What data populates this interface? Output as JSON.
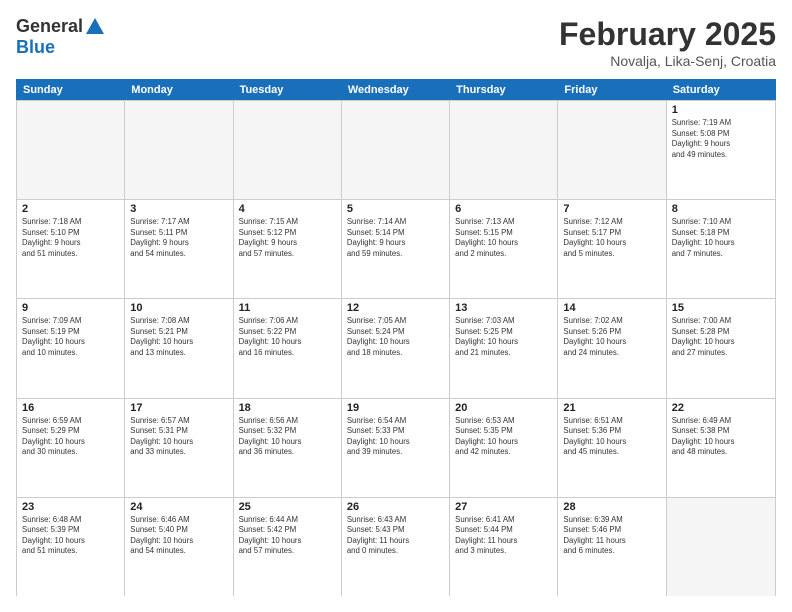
{
  "header": {
    "logo_line1": "General",
    "logo_line2": "Blue",
    "title": "February 2025",
    "subtitle": "Novalja, Lika-Senj, Croatia"
  },
  "weekdays": [
    "Sunday",
    "Monday",
    "Tuesday",
    "Wednesday",
    "Thursday",
    "Friday",
    "Saturday"
  ],
  "weeks": [
    [
      {
        "day": "",
        "info": ""
      },
      {
        "day": "",
        "info": ""
      },
      {
        "day": "",
        "info": ""
      },
      {
        "day": "",
        "info": ""
      },
      {
        "day": "",
        "info": ""
      },
      {
        "day": "",
        "info": ""
      },
      {
        "day": "1",
        "info": "Sunrise: 7:19 AM\nSunset: 5:08 PM\nDaylight: 9 hours\nand 49 minutes."
      }
    ],
    [
      {
        "day": "2",
        "info": "Sunrise: 7:18 AM\nSunset: 5:10 PM\nDaylight: 9 hours\nand 51 minutes."
      },
      {
        "day": "3",
        "info": "Sunrise: 7:17 AM\nSunset: 5:11 PM\nDaylight: 9 hours\nand 54 minutes."
      },
      {
        "day": "4",
        "info": "Sunrise: 7:15 AM\nSunset: 5:12 PM\nDaylight: 9 hours\nand 57 minutes."
      },
      {
        "day": "5",
        "info": "Sunrise: 7:14 AM\nSunset: 5:14 PM\nDaylight: 9 hours\nand 59 minutes."
      },
      {
        "day": "6",
        "info": "Sunrise: 7:13 AM\nSunset: 5:15 PM\nDaylight: 10 hours\nand 2 minutes."
      },
      {
        "day": "7",
        "info": "Sunrise: 7:12 AM\nSunset: 5:17 PM\nDaylight: 10 hours\nand 5 minutes."
      },
      {
        "day": "8",
        "info": "Sunrise: 7:10 AM\nSunset: 5:18 PM\nDaylight: 10 hours\nand 7 minutes."
      }
    ],
    [
      {
        "day": "9",
        "info": "Sunrise: 7:09 AM\nSunset: 5:19 PM\nDaylight: 10 hours\nand 10 minutes."
      },
      {
        "day": "10",
        "info": "Sunrise: 7:08 AM\nSunset: 5:21 PM\nDaylight: 10 hours\nand 13 minutes."
      },
      {
        "day": "11",
        "info": "Sunrise: 7:06 AM\nSunset: 5:22 PM\nDaylight: 10 hours\nand 16 minutes."
      },
      {
        "day": "12",
        "info": "Sunrise: 7:05 AM\nSunset: 5:24 PM\nDaylight: 10 hours\nand 18 minutes."
      },
      {
        "day": "13",
        "info": "Sunrise: 7:03 AM\nSunset: 5:25 PM\nDaylight: 10 hours\nand 21 minutes."
      },
      {
        "day": "14",
        "info": "Sunrise: 7:02 AM\nSunset: 5:26 PM\nDaylight: 10 hours\nand 24 minutes."
      },
      {
        "day": "15",
        "info": "Sunrise: 7:00 AM\nSunset: 5:28 PM\nDaylight: 10 hours\nand 27 minutes."
      }
    ],
    [
      {
        "day": "16",
        "info": "Sunrise: 6:59 AM\nSunset: 5:29 PM\nDaylight: 10 hours\nand 30 minutes."
      },
      {
        "day": "17",
        "info": "Sunrise: 6:57 AM\nSunset: 5:31 PM\nDaylight: 10 hours\nand 33 minutes."
      },
      {
        "day": "18",
        "info": "Sunrise: 6:56 AM\nSunset: 5:32 PM\nDaylight: 10 hours\nand 36 minutes."
      },
      {
        "day": "19",
        "info": "Sunrise: 6:54 AM\nSunset: 5:33 PM\nDaylight: 10 hours\nand 39 minutes."
      },
      {
        "day": "20",
        "info": "Sunrise: 6:53 AM\nSunset: 5:35 PM\nDaylight: 10 hours\nand 42 minutes."
      },
      {
        "day": "21",
        "info": "Sunrise: 6:51 AM\nSunset: 5:36 PM\nDaylight: 10 hours\nand 45 minutes."
      },
      {
        "day": "22",
        "info": "Sunrise: 6:49 AM\nSunset: 5:38 PM\nDaylight: 10 hours\nand 48 minutes."
      }
    ],
    [
      {
        "day": "23",
        "info": "Sunrise: 6:48 AM\nSunset: 5:39 PM\nDaylight: 10 hours\nand 51 minutes."
      },
      {
        "day": "24",
        "info": "Sunrise: 6:46 AM\nSunset: 5:40 PM\nDaylight: 10 hours\nand 54 minutes."
      },
      {
        "day": "25",
        "info": "Sunrise: 6:44 AM\nSunset: 5:42 PM\nDaylight: 10 hours\nand 57 minutes."
      },
      {
        "day": "26",
        "info": "Sunrise: 6:43 AM\nSunset: 5:43 PM\nDaylight: 11 hours\nand 0 minutes."
      },
      {
        "day": "27",
        "info": "Sunrise: 6:41 AM\nSunset: 5:44 PM\nDaylight: 11 hours\nand 3 minutes."
      },
      {
        "day": "28",
        "info": "Sunrise: 6:39 AM\nSunset: 5:46 PM\nDaylight: 11 hours\nand 6 minutes."
      },
      {
        "day": "",
        "info": ""
      }
    ]
  ]
}
